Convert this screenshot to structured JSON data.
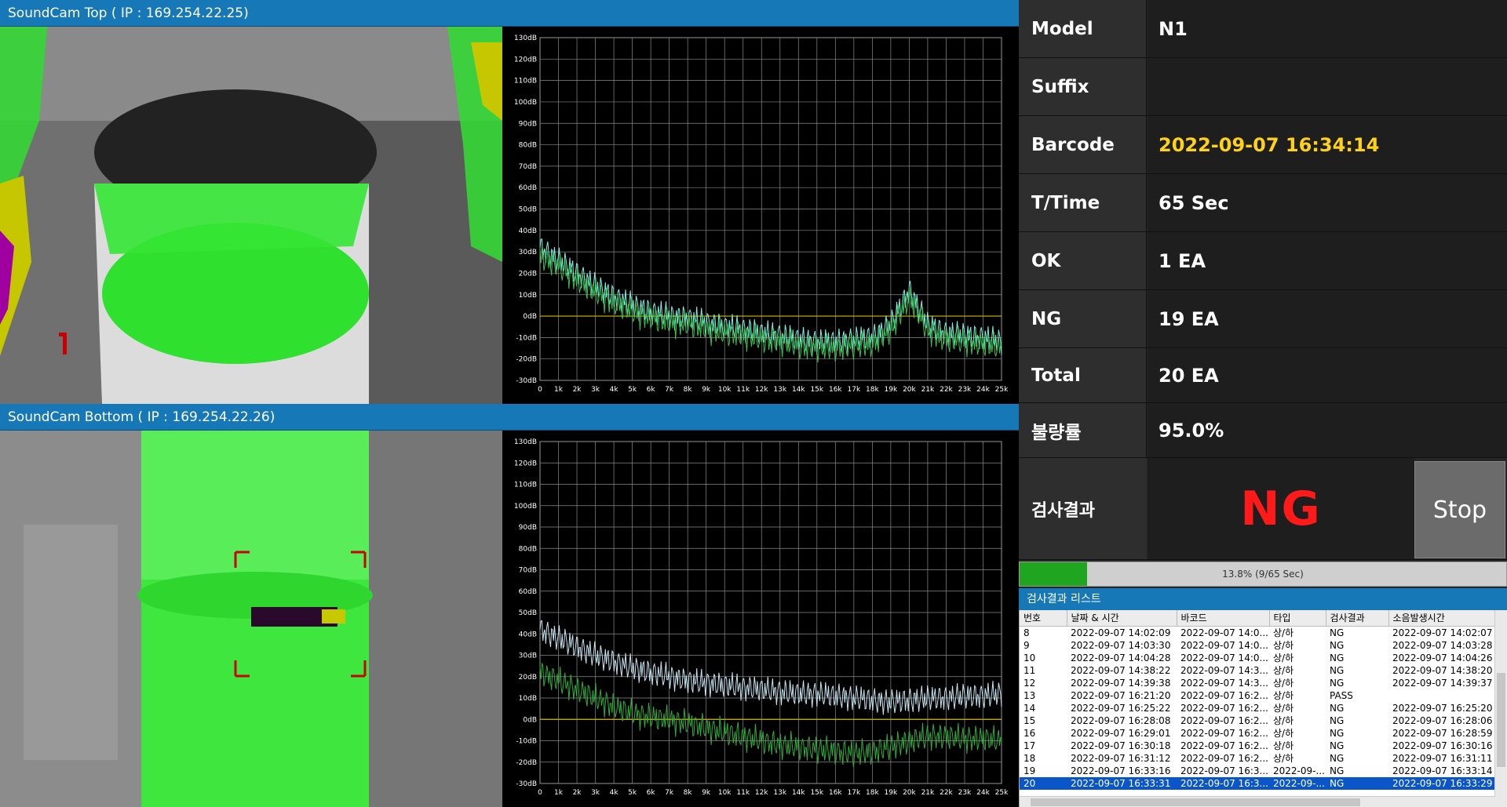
{
  "cameras": {
    "top": {
      "title": "SoundCam Top ( IP : 169.254.22.25)"
    },
    "bottom": {
      "title": "SoundCam Bottom ( IP : 169.254.22.26)"
    }
  },
  "info": {
    "model": {
      "label": "Model",
      "value": "N1"
    },
    "suffix": {
      "label": "Suffix",
      "value": ""
    },
    "barcode": {
      "label": "Barcode",
      "value": "2022-09-07 16:34:14"
    },
    "ttime": {
      "label": "T/Time",
      "value": "65 Sec"
    },
    "ok": {
      "label": "OK",
      "value": "1 EA"
    },
    "ng": {
      "label": "NG",
      "value": "19 EA"
    },
    "total": {
      "label": "Total",
      "value": "20 EA"
    },
    "rate": {
      "label": "불량률",
      "value": "95.0%"
    }
  },
  "result": {
    "label": "검사결과",
    "value": "NG",
    "value_color": "#ff1a1a"
  },
  "stop_label": "Stop",
  "progress": {
    "text": "13.8% (9/65 Sec)",
    "fraction": 0.138
  },
  "list": {
    "title": "검사결과 리스트",
    "columns": [
      "번호",
      "날짜 & 시간",
      "바코드",
      "타입",
      "검사결과",
      "소음발생시간"
    ],
    "rows": [
      [
        "8",
        "2022-09-07 14:02:09",
        "2022-09-07 14:0...",
        "상/하",
        "NG",
        "2022-09-07 14:02:07"
      ],
      [
        "9",
        "2022-09-07 14:03:30",
        "2022-09-07 14:0...",
        "상/하",
        "NG",
        "2022-09-07 14:03:28"
      ],
      [
        "10",
        "2022-09-07 14:04:28",
        "2022-09-07 14:0...",
        "상/하",
        "NG",
        "2022-09-07 14:04:26"
      ],
      [
        "11",
        "2022-09-07 14:38:22",
        "2022-09-07 14:3...",
        "상/하",
        "NG",
        "2022-09-07 14:38:20"
      ],
      [
        "12",
        "2022-09-07 14:39:38",
        "2022-09-07 14:3...",
        "상/하",
        "NG",
        "2022-09-07 14:39:37"
      ],
      [
        "13",
        "2022-09-07 16:21:20",
        "2022-09-07 16:2...",
        "상/하",
        "PASS",
        ""
      ],
      [
        "14",
        "2022-09-07 16:25:22",
        "2022-09-07 16:2...",
        "상/하",
        "NG",
        "2022-09-07 16:25:20"
      ],
      [
        "15",
        "2022-09-07 16:28:08",
        "2022-09-07 16:2...",
        "상/하",
        "NG",
        "2022-09-07 16:28:06"
      ],
      [
        "16",
        "2022-09-07 16:29:01",
        "2022-09-07 16:2...",
        "상/하",
        "NG",
        "2022-09-07 16:28:59"
      ],
      [
        "17",
        "2022-09-07 16:30:18",
        "2022-09-07 16:2...",
        "상/하",
        "NG",
        "2022-09-07 16:30:16"
      ],
      [
        "18",
        "2022-09-07 16:31:12",
        "2022-09-07 16:2...",
        "상/하",
        "NG",
        "2022-09-07 16:31:11"
      ],
      [
        "19",
        "2022-09-07 16:33:16",
        "2022-09-07 16:3...",
        "2022-09-...",
        "NG",
        "2022-09-07 16:33:14"
      ],
      [
        "20",
        "2022-09-07 16:33:31",
        "2022-09-07 16:3...",
        "2022-09-...",
        "NG",
        "2022-09-07 16:33:29"
      ]
    ],
    "selected_index": 12
  },
  "chart_data": [
    {
      "type": "line",
      "panel": "top",
      "x_ticks": [
        "0",
        "1k",
        "2k",
        "3k",
        "4k",
        "5k",
        "6k",
        "7k",
        "8k",
        "9k",
        "10k",
        "11k",
        "12k",
        "13k",
        "14k",
        "15k",
        "16k",
        "17k",
        "18k",
        "19k",
        "20k",
        "21k",
        "22k",
        "23k",
        "24k",
        "25k"
      ],
      "y_ticks": [
        "130dB",
        "120dB",
        "110dB",
        "100dB",
        "90dB",
        "80dB",
        "70dB",
        "60dB",
        "50dB",
        "40dB",
        "30dB",
        "20dB",
        "10dB",
        "0dB",
        "-10dB",
        "-20dB",
        "-30dB"
      ],
      "xlim": [
        0,
        25000
      ],
      "ylim": [
        -30,
        130
      ],
      "grid": true,
      "reference_line_db": 0,
      "series": [
        {
          "color": "#7ff0e8",
          "x": [
            0,
            1000,
            2000,
            3000,
            4000,
            5000,
            6000,
            7000,
            8000,
            9000,
            10000,
            11000,
            12000,
            13000,
            14000,
            15000,
            16000,
            17000,
            18000,
            19000,
            19500,
            20000,
            20500,
            21000,
            22000,
            23000,
            24000,
            25000
          ],
          "y": [
            32,
            26,
            20,
            14,
            9,
            5,
            2,
            0,
            -1,
            -3,
            -5,
            -6,
            -8,
            -9,
            -11,
            -12,
            -12,
            -11,
            -10,
            -4,
            4,
            12,
            4,
            -4,
            -8,
            -9,
            -10,
            -12
          ]
        },
        {
          "color": "#39c24a",
          "x": [
            0,
            1000,
            2000,
            3000,
            4000,
            5000,
            6000,
            7000,
            8000,
            9000,
            10000,
            11000,
            12000,
            13000,
            14000,
            15000,
            16000,
            17000,
            18000,
            19000,
            19500,
            20000,
            20500,
            21000,
            22000,
            23000,
            24000,
            25000
          ],
          "y": [
            28,
            23,
            17,
            11,
            6,
            2,
            -1,
            -3,
            -4,
            -6,
            -8,
            -9,
            -11,
            -12,
            -14,
            -15,
            -15,
            -14,
            -13,
            -7,
            1,
            9,
            1,
            -7,
            -11,
            -12,
            -13,
            -15
          ]
        }
      ]
    },
    {
      "type": "line",
      "panel": "bottom",
      "x_ticks": [
        "0",
        "1k",
        "2k",
        "3k",
        "4k",
        "5k",
        "6k",
        "7k",
        "8k",
        "9k",
        "10k",
        "11k",
        "12k",
        "13k",
        "14k",
        "15k",
        "16k",
        "17k",
        "18k",
        "19k",
        "20k",
        "21k",
        "22k",
        "23k",
        "24k",
        "25k"
      ],
      "y_ticks": [
        "130dB",
        "120dB",
        "110dB",
        "100dB",
        "90dB",
        "80dB",
        "70dB",
        "60dB",
        "50dB",
        "40dB",
        "30dB",
        "20dB",
        "10dB",
        "0dB",
        "-10dB",
        "-20dB",
        "-30dB"
      ],
      "xlim": [
        0,
        25000
      ],
      "ylim": [
        -30,
        130
      ],
      "grid": true,
      "reference_line_db": 0,
      "series": [
        {
          "color": "#c6e6f2",
          "x": [
            0,
            1000,
            2000,
            3000,
            4000,
            5000,
            6000,
            7000,
            8000,
            9000,
            10000,
            11000,
            12000,
            13000,
            14000,
            15000,
            16000,
            17000,
            18000,
            19000,
            20000,
            21000,
            22000,
            23000,
            24000,
            25000
          ],
          "y": [
            42,
            38,
            34,
            30,
            27,
            24,
            22,
            20,
            18,
            17,
            16,
            15,
            14,
            13,
            12,
            12,
            11,
            10,
            9,
            8,
            9,
            10,
            10,
            11,
            11,
            12
          ]
        },
        {
          "color": "#2fae3a",
          "x": [
            0,
            1000,
            2000,
            3000,
            4000,
            5000,
            6000,
            7000,
            8000,
            9000,
            10000,
            11000,
            12000,
            13000,
            14000,
            15000,
            16000,
            17000,
            18000,
            19000,
            20000,
            21000,
            22000,
            23000,
            24000,
            25000
          ],
          "y": [
            22,
            18,
            14,
            10,
            6,
            3,
            1,
            0,
            -2,
            -4,
            -6,
            -8,
            -10,
            -12,
            -13,
            -14,
            -15,
            -16,
            -15,
            -13,
            -10,
            -8,
            -8,
            -9,
            -9,
            -10
          ]
        }
      ]
    }
  ]
}
